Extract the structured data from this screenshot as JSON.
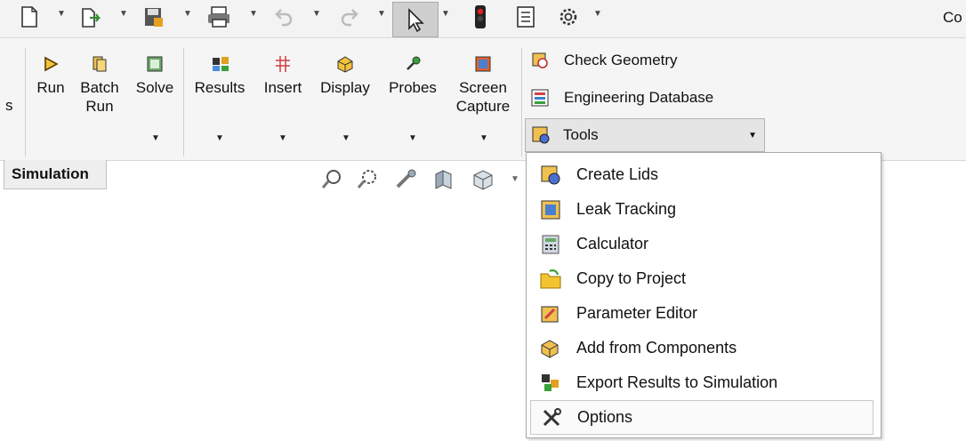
{
  "app_title_fragment": "Co",
  "quick_access": {
    "icons": [
      "new-document-icon",
      "open-file-icon",
      "save-icon",
      "print-icon",
      "undo-icon",
      "redo-icon",
      "select-pointer-icon",
      "traffic-light-icon",
      "list-icon",
      "gear-icon"
    ]
  },
  "ribbon": {
    "left_fragment": "s",
    "run": {
      "label": "Run"
    },
    "batch_run": {
      "label_line1": "Batch",
      "label_line2": "Run"
    },
    "solve": {
      "label": "Solve"
    },
    "results": {
      "label": "Results"
    },
    "insert": {
      "label": "Insert"
    },
    "display": {
      "label": "Display"
    },
    "probes": {
      "label": "Probes"
    },
    "screen_capture": {
      "label_line1": "Screen",
      "label_line2": "Capture"
    },
    "check_geometry": {
      "label": "Check Geometry"
    },
    "engineering_database": {
      "label": "Engineering Database"
    },
    "tools": {
      "label": "Tools"
    }
  },
  "tabs": {
    "simulation": {
      "label": "Simulation"
    }
  },
  "tools_menu": {
    "items": [
      {
        "label": "Create Lids",
        "icon": "create-lids-icon"
      },
      {
        "label": "Leak Tracking",
        "icon": "leak-tracking-icon"
      },
      {
        "label": "Calculator",
        "icon": "calculator-icon"
      },
      {
        "label": "Copy to Project",
        "icon": "copy-to-project-icon"
      },
      {
        "label": "Parameter Editor",
        "icon": "parameter-editor-icon"
      },
      {
        "label": "Add from Components",
        "icon": "add-from-components-icon"
      },
      {
        "label": "Export Results to Simulation",
        "icon": "export-results-icon"
      },
      {
        "label": "Options",
        "icon": "options-tools-icon"
      }
    ],
    "highlighted": "Options"
  },
  "colors": {
    "ribbon_bg": "#f5f5f5",
    "tools_dropdown_bg": "#e5e5e5",
    "menu_border": "#a9a9a9"
  }
}
